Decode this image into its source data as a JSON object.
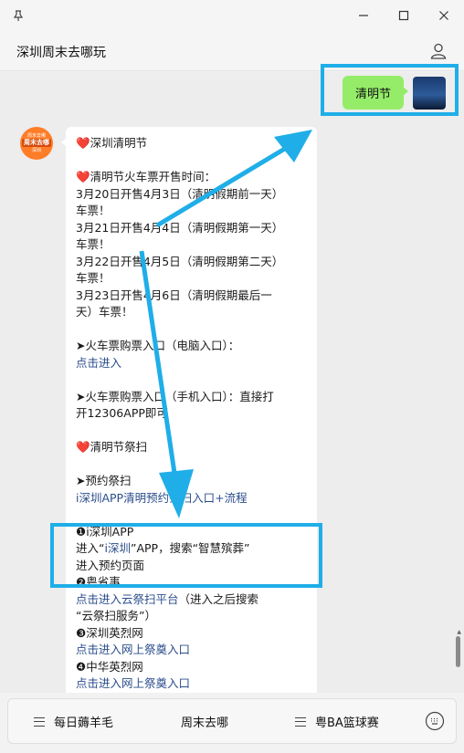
{
  "window": {
    "pin_icon": "pin-icon",
    "minimize_icon": "minimize-icon",
    "maximize_icon": "maximize-icon",
    "close_icon": "close-icon"
  },
  "header": {
    "title": "深圳周末去哪玩",
    "profile_icon": "person-icon"
  },
  "outgoing": {
    "text": "清明节"
  },
  "official_avatar": {
    "top": "周末去哪",
    "mid": "周末去哪",
    "bottom": "深圳"
  },
  "message": {
    "l01": "❤️深圳清明节",
    "l02": "❤️清明节火车票开售时间：",
    "l03": "3月20日开售4月3日（清明假期前一天）",
    "l04": "车票！",
    "l05": "3月21日开售4月4日（清明假期第一天）",
    "l06": "车票！",
    "l07": "3月22日开售4月5日（清明假期第二天）",
    "l08": "车票！",
    "l09": "3月23日开售4月6日（清明假期最后一",
    "l10": "天）车票！",
    "l11": "➤火车票购票入口（电脑入口）：",
    "l12": "点击进入",
    "l13": "➤火车票购票入口（手机入口）：直接打",
    "l14": "开12306APP即可",
    "l15": "❤️清明节祭扫",
    "l16": "➤预约祭扫",
    "l17": "i深圳APP清明预约祭扫入口+流程",
    "l18": "❶i深圳APP",
    "l19_a": "进入“",
    "l19_link": "i深圳",
    "l19_b": "”APP，搜索“智慧殡葬”",
    "l20": "进入预约页面",
    "l21": "❷粤省事",
    "l22_link": "点击进入云祭扫平台",
    "l22_b": "（进入之后搜索",
    "l23": "“云祭扫服务”）",
    "l24": "❸深圳英烈网",
    "l25": "点击进入网上祭奠入口",
    "l26": "❹中华英烈网",
    "l27": "点击进入网上祭奠入口"
  },
  "menu": {
    "item1": "每日薅羊毛",
    "item2": "周末去哪",
    "item3": "粤BA篮球赛",
    "keyboard_icon": "keyboard-icon"
  },
  "colors": {
    "highlight": "#1faee8",
    "bubble_out": "#95ec69",
    "link": "#2b4d8c"
  }
}
